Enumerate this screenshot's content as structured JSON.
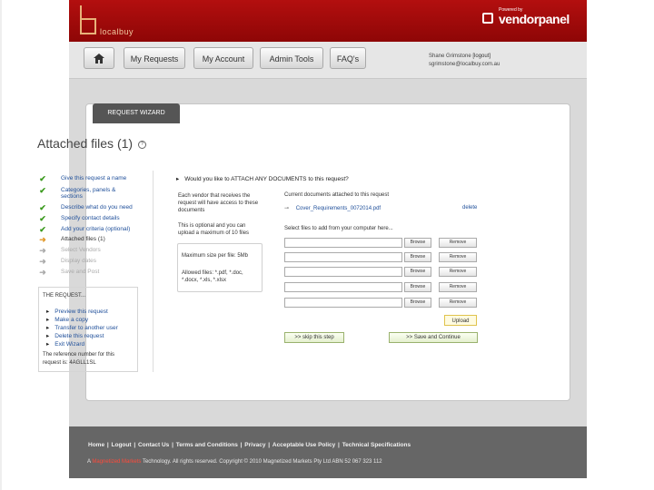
{
  "brand": {
    "logo_text": "localbuy",
    "powered_by": "Powered by",
    "vendor": "vendorpanel"
  },
  "nav": {
    "home_icon": "home-icon",
    "items": [
      "My Requests",
      "My Account",
      "Admin Tools",
      "FAQ's"
    ]
  },
  "user": {
    "name": "Shane Grimstone",
    "logout": "[logout]",
    "email": "sgrimstone@localbuy.com.au"
  },
  "wizard": {
    "tab": "REQUEST WIZARD",
    "title": "Attached files (1)",
    "help": "?"
  },
  "steps": [
    {
      "label": "Give this request a name",
      "status": "done"
    },
    {
      "label": "Categories, panels &",
      "status": "done"
    },
    {
      "label": "sections",
      "status": "done"
    },
    {
      "label": "Describe what do you need",
      "status": "done"
    },
    {
      "label": "Specify contact details",
      "status": "done"
    },
    {
      "label": "Add your criteria (optional)",
      "status": "done"
    },
    {
      "label": "Attached files (1)",
      "status": "current"
    },
    {
      "label": "Select Vendors",
      "status": "todo"
    },
    {
      "label": "Display dates",
      "status": "todo"
    },
    {
      "label": "Save and Post",
      "status": "todo"
    }
  ],
  "request_box": {
    "heading": "THE REQUEST...",
    "actions": [
      "Preview this request",
      "Make a copy",
      "Transfer to another user",
      "Delete this request",
      "Exit Wizard"
    ],
    "reference": "The reference number for this request is: 4AGLL1SL"
  },
  "attach": {
    "question": "Would you like to ATTACH ANY DOCUMENTS to this request?",
    "desc1": "Each vendor that receives the request will have access to these documents",
    "desc2": "This is optional and you can upload a maximum of 10 files",
    "max_size": "Maximum size per file: 5Mb",
    "allowed": "Allowed files: *.pdf, *.doc, *.docx, *.xls, *.xlsx",
    "current_heading": "Current documents attached to this request",
    "current_file": "Cover_Requirements_0072014.pdf",
    "delete": "delete",
    "select_heading": "Select files to add from your computer here...",
    "browse": "Browse",
    "remove": "Remove",
    "upload": "Upload",
    "skip": ">> skip this step",
    "save": ">> Save and Continue"
  },
  "footer": {
    "links": [
      "Home",
      "Logout",
      "Contact Us",
      "Terms and Conditions",
      "Privacy",
      "Acceptable Use Policy",
      "Technical Specifications"
    ],
    "copy_prefix": "A",
    "copy_brand": "Magnetized Markets",
    "copy_rest": "Technology. All rights reserved. Copyright © 2010 Magnetized Markets Pty Ltd ABN 52 067 323 112"
  }
}
